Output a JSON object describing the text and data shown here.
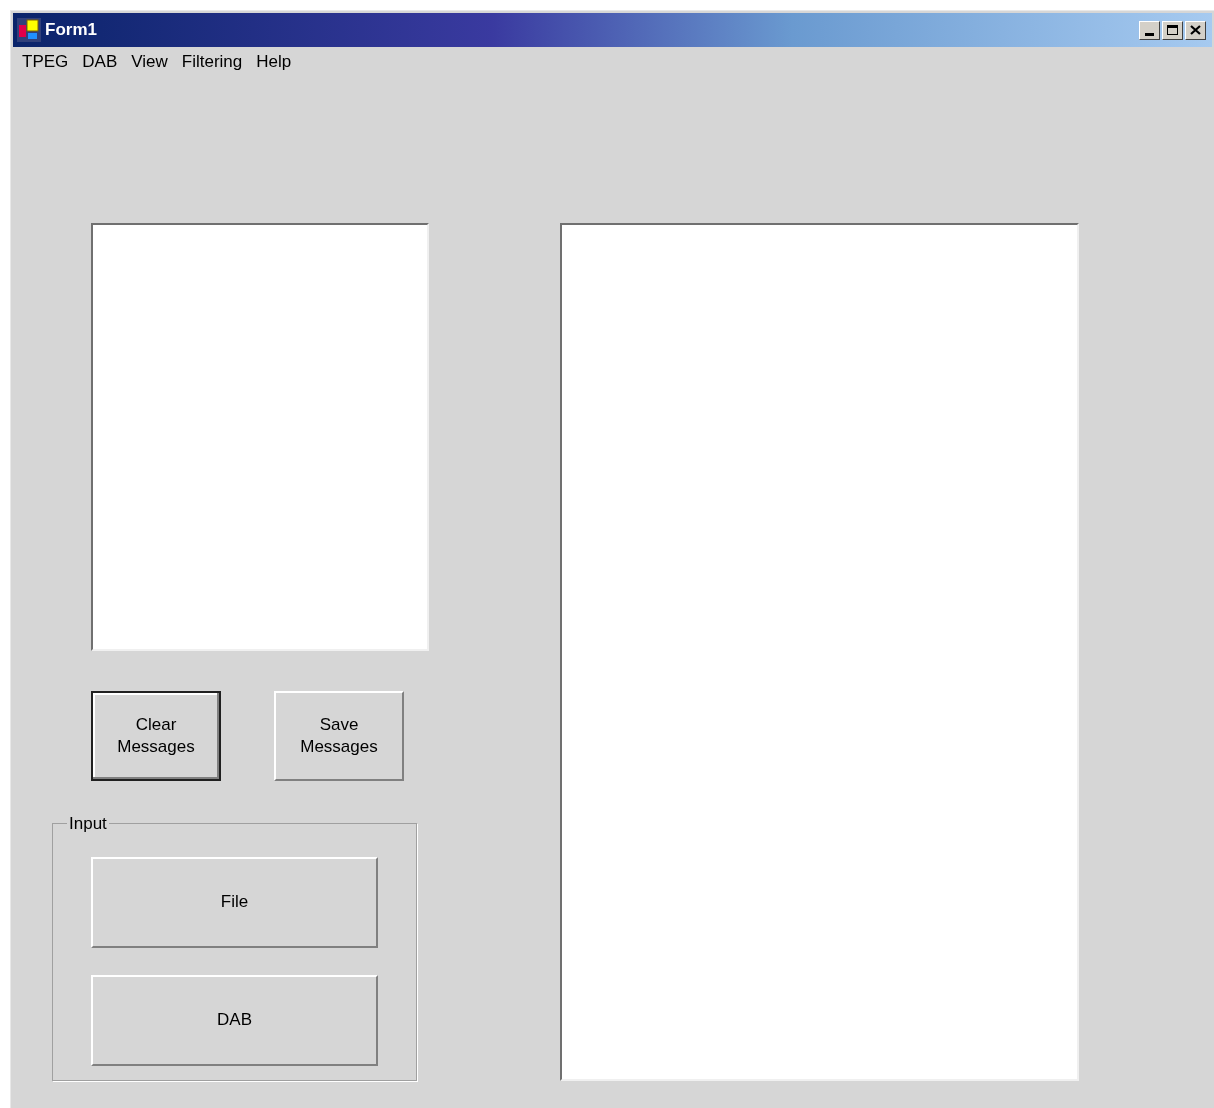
{
  "window": {
    "title": "Form1"
  },
  "menu": [
    "TPEG",
    "DAB",
    "View",
    "Filtering",
    "Help"
  ],
  "message_buttons": [
    {
      "label": "Clear Messages",
      "default": true
    },
    {
      "label": "Save Messages",
      "default": false
    }
  ],
  "input_group": {
    "title": "Input",
    "buttons": [
      "File",
      "DAB"
    ]
  }
}
